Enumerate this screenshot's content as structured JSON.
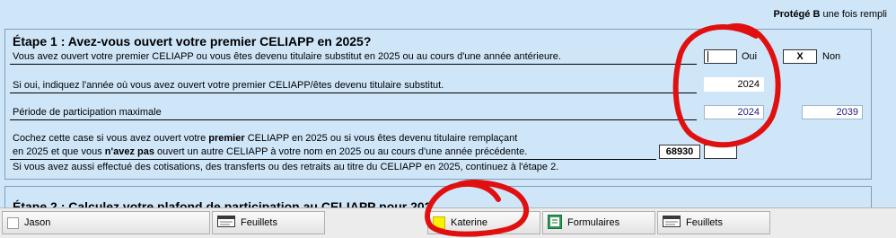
{
  "header": {
    "protect_bold": "Protégé B",
    "protect_rest": " une fois rempli"
  },
  "step1": {
    "title": "Étape 1 : Avez-vous ouvert votre premier CELIAPP en 2025?",
    "q1": "Vous avez ouvert votre premier CELIAPP ou vous êtes devenu titulaire substitut en 2025 ou au cours d'une année antérieure.",
    "oui_label": "Oui",
    "oui_value": "",
    "non_label": "Non",
    "non_value": "X",
    "q2": "Si oui, indiquez l'année où vous avez ouvert votre premier CELIAPP/êtes devenu titulaire substitut.",
    "year_opened": "2024",
    "q3": "Période de participation maximale",
    "period_start": "2024",
    "period_end": "2039",
    "q4_line1_pre": "Cochez cette case si vous avez ouvert votre ",
    "q4_line1_bold": "premier",
    "q4_line1_post": " CELIAPP en 2025 ou si vous êtes devenu titulaire remplaçant",
    "q4_line2_pre": "en 2025 et que vous ",
    "q4_line2_bold": "n'avez pas",
    "q4_line2_post": " ouvert un autre CELIAPP à votre nom en 2025 ou au cours d'une année précédente.",
    "code": "68930",
    "checkbox_value": "",
    "q5": "Si vous avez aussi effectué des cotisations, des transferts ou des retraits au titre du CELIAPP en 2025, continuez à l'étape 2."
  },
  "step2": {
    "title_partial": "Étape 2 : Calculez votre plafond de participation au CELIAPP pour 202"
  },
  "taskbar": {
    "items": [
      {
        "label": "Jason",
        "icon": "checkbox-icon"
      },
      {
        "label": "Feuillets",
        "icon": "slips-icon"
      },
      {
        "label": "Katerine",
        "icon": "yellow-square-icon"
      },
      {
        "label": "Formulaires",
        "icon": "forms-icon"
      },
      {
        "label": "Feuillets",
        "icon": "slips-icon"
      }
    ]
  },
  "colors": {
    "panel": "#cfe6f9",
    "annotation": "#e01010",
    "value_blue": "#202080"
  }
}
